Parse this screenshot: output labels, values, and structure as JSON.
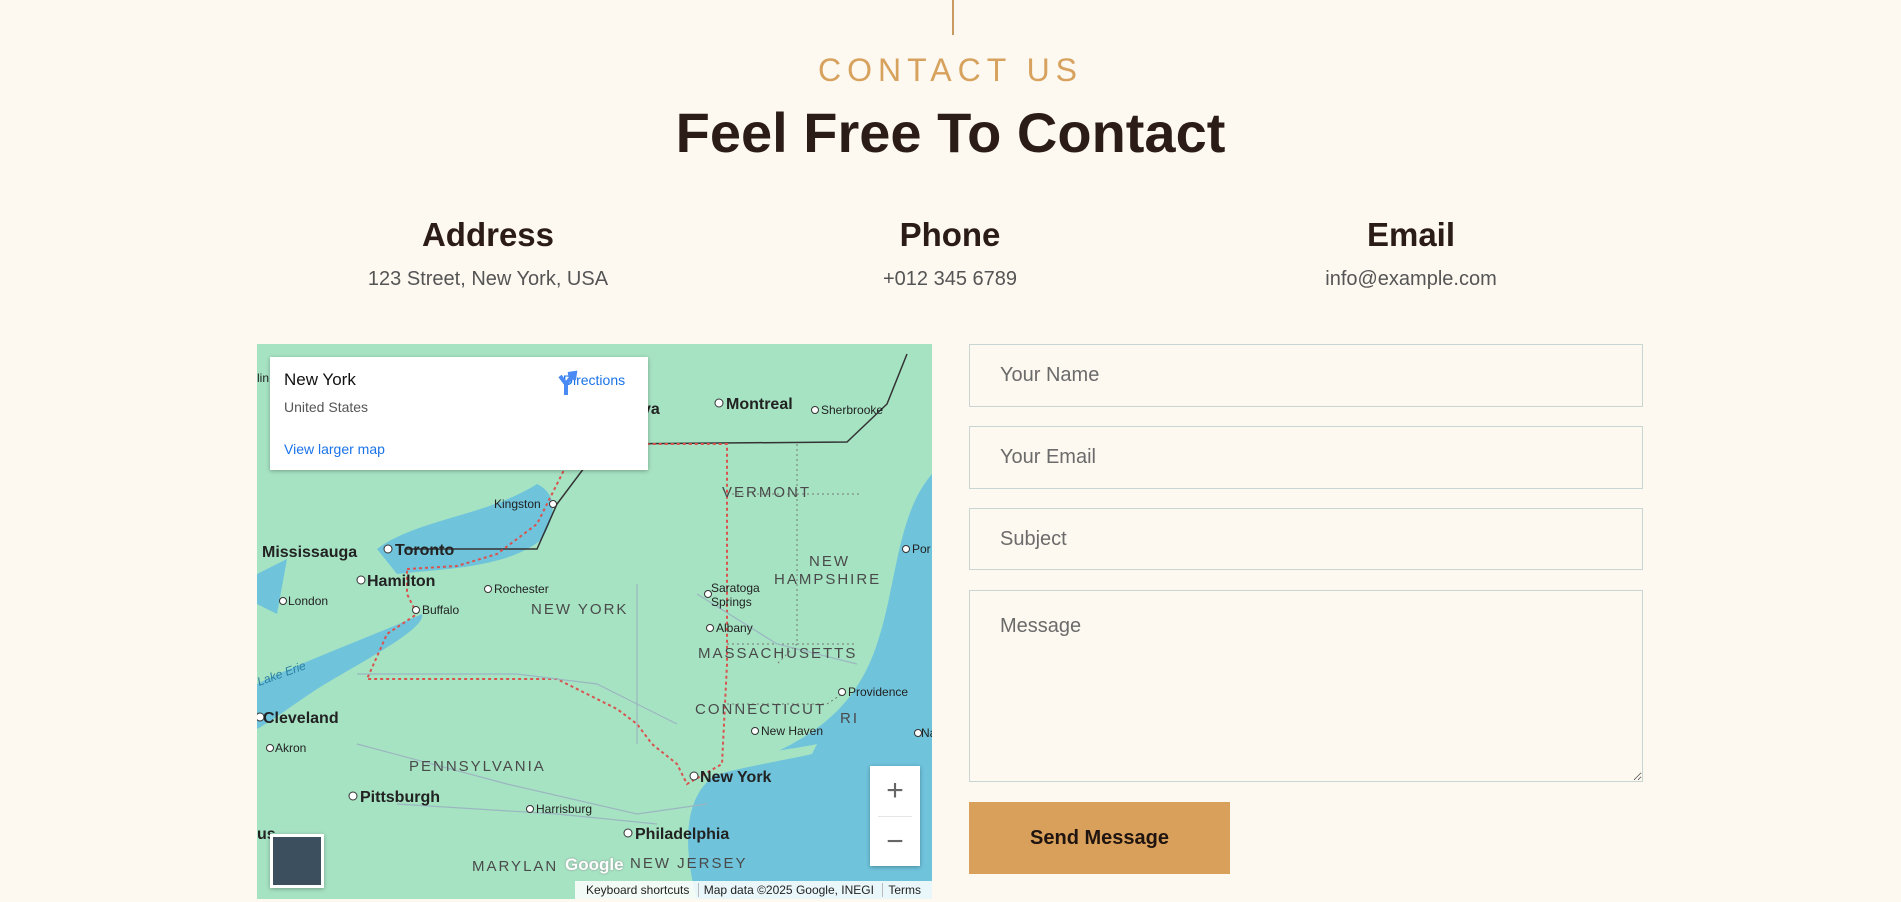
{
  "header": {
    "eyebrow": "CONTACT US",
    "title": "Feel Free To Contact"
  },
  "info": {
    "address": {
      "label": "Address",
      "value": "123 Street, New York, USA"
    },
    "phone": {
      "label": "Phone",
      "value": "+012 345 6789"
    },
    "email": {
      "label": "Email",
      "value": "info@example.com"
    }
  },
  "map": {
    "place_name": "New York",
    "place_country": "United States",
    "directions_label": "Directions",
    "view_larger": "View larger map",
    "logo": "Google",
    "attribution": [
      "Keyboard shortcuts",
      "Map data ©2025 Google, INEGI",
      "Terms"
    ],
    "labels": {
      "montreal": "Montreal",
      "sherbrooke": "Sherbrooke",
      "ottawa": "va",
      "kingston": "Kingston",
      "vermont": "VERMONT",
      "mississauga": "Mississauga",
      "toronto": "Toronto",
      "hamilton": "Hamilton",
      "rochester": "Rochester",
      "new_hampshire_1": "NEW",
      "new_hampshire_2": "HAMPSHIRE",
      "portland": "Por",
      "london": "London",
      "buffalo": "Buffalo",
      "new_york_state": "NEW YORK",
      "saratoga_1": "Saratoga",
      "saratoga_2": "Springs",
      "albany": "Albany",
      "lake_erie": "Lake Erie",
      "massachusetts": "MASSACHUSETTS",
      "cleveland": "Cleveland",
      "connecticut": "CONNECTICUT",
      "providence": "Providence",
      "ri": "RI",
      "new_haven": "New Haven",
      "nashua": "Na",
      "akron": "Akron",
      "pennsylvania": "PENNSYLVANIA",
      "new_york_city": "New York",
      "pittsburgh": "Pittsburgh",
      "harrisburg": "Harrisburg",
      "us": "us",
      "philadelphia": "Philadelphia",
      "maryland": "MARYLAN",
      "new_jersey": "NEW JERSEY",
      "lin": "lin"
    }
  },
  "form": {
    "name_placeholder": "Your Name",
    "email_placeholder": "Your Email",
    "subject_placeholder": "Subject",
    "message_placeholder": "Message",
    "submit_label": "Send Message"
  },
  "colors": {
    "background": "#fdf8f0",
    "accent": "#d9a05b",
    "heading": "#2b1c18"
  }
}
